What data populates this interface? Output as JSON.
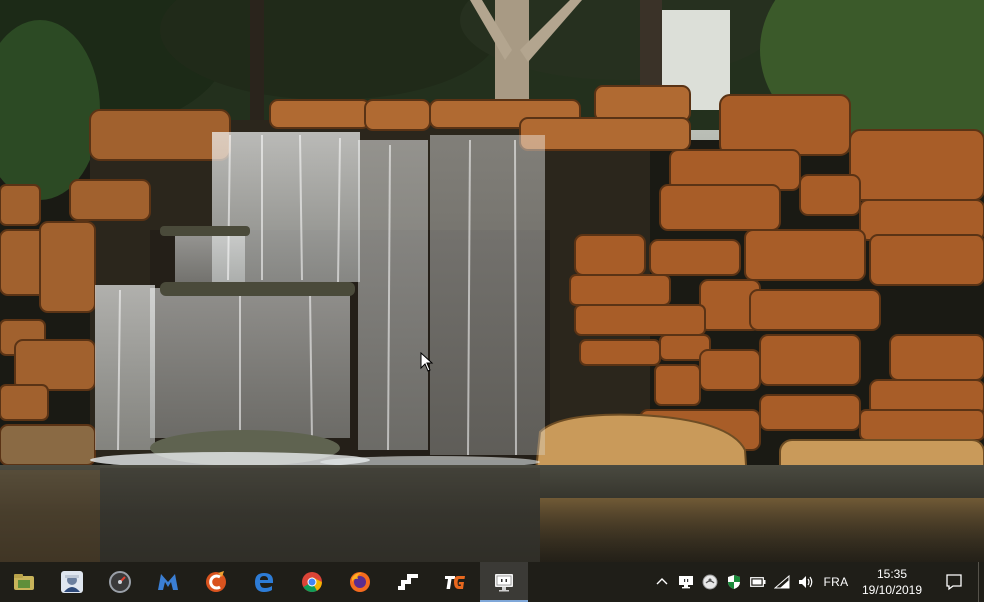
{
  "desktop": {
    "wallpaper": "waterfall-over-rocks-photo"
  },
  "taskbar": {
    "pinned": [
      {
        "name": "file-explorer-app-icon",
        "icon": "folder-icon",
        "active": false
      },
      {
        "name": "support-agent-app-icon",
        "icon": "person-headset-icon",
        "active": false
      },
      {
        "name": "speedometer-app-icon",
        "icon": "speedometer-icon",
        "active": false
      },
      {
        "name": "malwarebytes-app-icon",
        "icon": "malwarebytes-icon",
        "active": false
      },
      {
        "name": "ccleaner-app-icon",
        "icon": "ccleaner-icon",
        "active": false
      },
      {
        "name": "edge-app-icon",
        "icon": "edge-icon",
        "active": false
      },
      {
        "name": "chrome-app-icon",
        "icon": "chrome-icon",
        "active": false
      },
      {
        "name": "firefox-app-icon",
        "icon": "firefox-icon",
        "active": false
      },
      {
        "name": "stairs-app-icon",
        "icon": "stairs-icon",
        "active": false
      },
      {
        "name": "tg-app-icon",
        "icon": "tg-logo-icon",
        "active": false
      },
      {
        "name": "remote-desktop-app-icon",
        "icon": "monitor-icon",
        "active": true
      }
    ],
    "tray": {
      "chevron": "^",
      "language": "FRA",
      "time": "15:35",
      "date": "19/10/2019"
    },
    "colors": {
      "background": "#1f1e18",
      "active_indicator": "#7fa7d8"
    }
  }
}
